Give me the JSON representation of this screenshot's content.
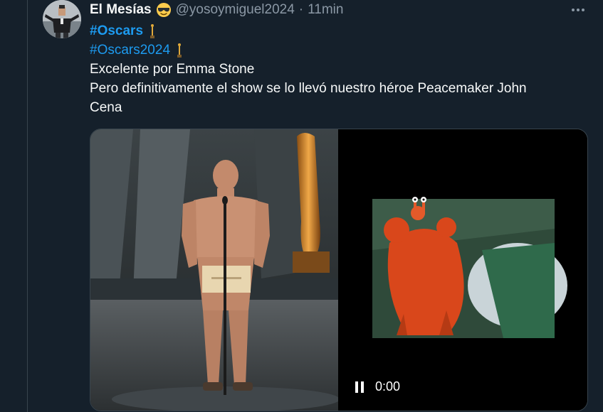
{
  "tweet": {
    "author_name": "El Mesías",
    "handle": "@yosoymiguel2024",
    "separator": "·",
    "time": "11min",
    "lines": [
      "Excelente por Emma Stone",
      "Pero definitivamente el show se lo llevó nuestro héroe Peacemaker John",
      "Cena"
    ],
    "hashtags": [
      "#Oscars",
      "#Oscars2024"
    ]
  },
  "video": {
    "timestamp": "0:00"
  },
  "colors": {
    "background": "#15202b",
    "link": "#1d9bf0",
    "muted": "#8b98a5",
    "border": "#38444d"
  },
  "icons": [
    "avatar",
    "sunglasses-emoji-icon",
    "oscar-trophy-icon",
    "more-options-icon",
    "pause-icon"
  ]
}
